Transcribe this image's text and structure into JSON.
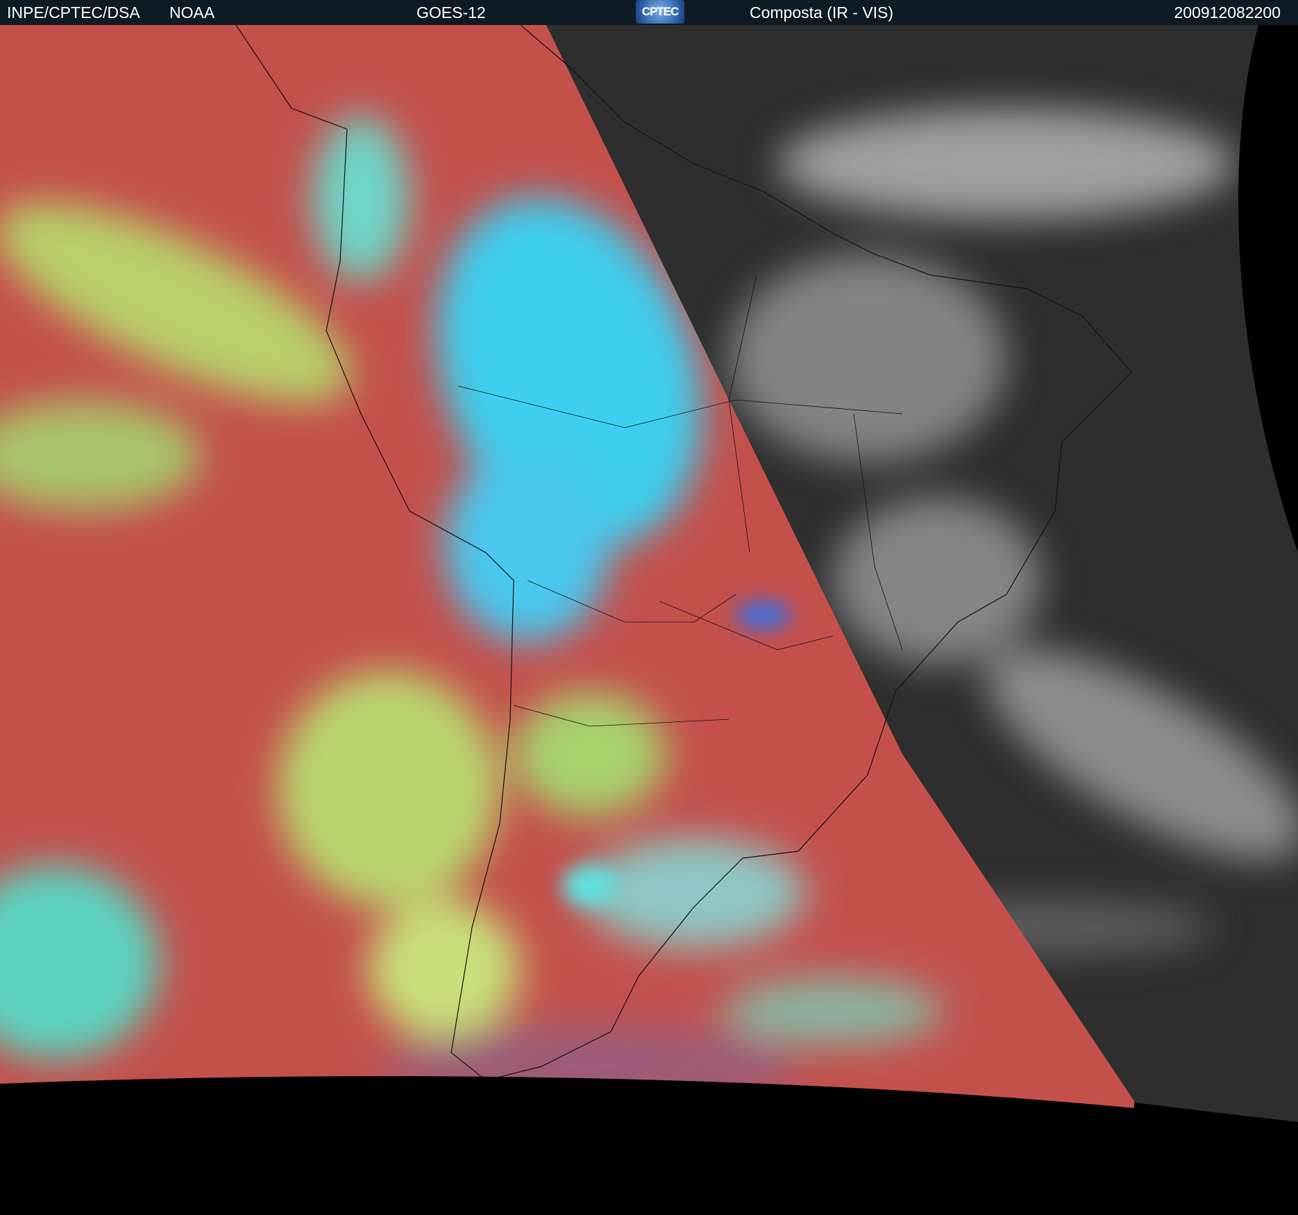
{
  "header": {
    "org": "INPE/CPTEC/DSA",
    "agency": "NOAA",
    "satellite": "GOES-12",
    "logo_text": "CPTEC",
    "product": "Composta (IR - VIS)",
    "timestamp": "200912082200"
  },
  "colors": {
    "header_bg": "#0e1b24",
    "ir_warm": "#c9504a",
    "ir_cloud_green": "#a8d86a",
    "ir_cloud_cyan": "#3ad8f0",
    "vis_gray": "#3a3a3a"
  }
}
